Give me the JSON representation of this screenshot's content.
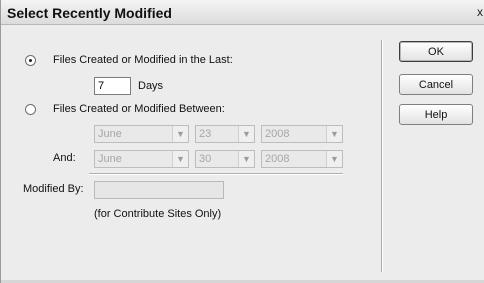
{
  "window": {
    "title": "Select Recently Modified",
    "close_glyph": "x"
  },
  "option_last": {
    "label": "Files Created or Modified in the Last:",
    "selected": true
  },
  "days": {
    "value": "7",
    "unit": "Days"
  },
  "option_between": {
    "label": "Files Created or Modified Between:",
    "selected": false
  },
  "from_date": {
    "month": "June",
    "day": "23",
    "year": "2008"
  },
  "and_label": "And:",
  "to_date": {
    "month": "June",
    "day": "30",
    "year": "2008"
  },
  "modified_by": {
    "label": "Modified By:",
    "value": "",
    "note": "(for Contribute Sites Only)"
  },
  "buttons": {
    "ok": "OK",
    "cancel": "Cancel",
    "help": "Help"
  },
  "icons": {
    "dropdown": "chevron-down-icon",
    "close": "close-icon"
  }
}
